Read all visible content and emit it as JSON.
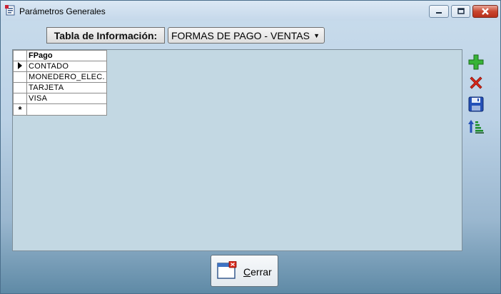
{
  "window": {
    "title": "Parámetros Generales"
  },
  "controls": {
    "min_icon": "minimize-icon",
    "max_icon": "maximize-icon",
    "close_icon": "close-icon"
  },
  "filter": {
    "label": "Tabla de Información:",
    "selected": "FORMAS DE PAGO - VENTAS"
  },
  "grid": {
    "column_header": "FPago",
    "rows": [
      "CONTADO",
      "MONEDERO_ELEC.",
      "TARJETA",
      "VISA"
    ],
    "current_row": 0,
    "new_row_marker": "*"
  },
  "toolbar": {
    "add_icon": "plus-icon",
    "delete_icon": "x-icon",
    "save_icon": "floppy-disk-icon",
    "sort_icon": "sort-icon"
  },
  "footer": {
    "close_label": "Cerrar"
  },
  "colors": {
    "add": "#2fa52f",
    "delete": "#d22a1e",
    "save": "#1a3f9c"
  }
}
